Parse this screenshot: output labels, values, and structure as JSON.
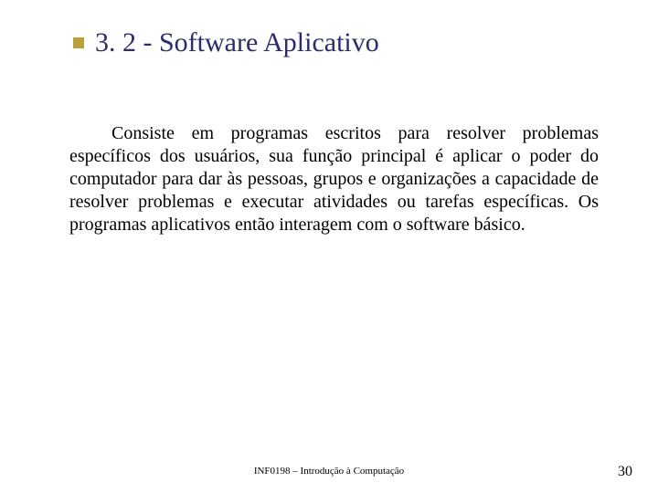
{
  "slide": {
    "title": "3. 2 - Software Aplicativo",
    "body": "Consiste em programas escritos para resolver problemas específicos dos usuários, sua função principal é aplicar o poder do computador para dar às pessoas, grupos e organizações a capacidade de resolver problemas e executar atividades ou tarefas específicas. Os programas aplicativos então interagem com o software básico.",
    "footer": "INF0198 – Introdução à Computação",
    "page_number": "30"
  }
}
